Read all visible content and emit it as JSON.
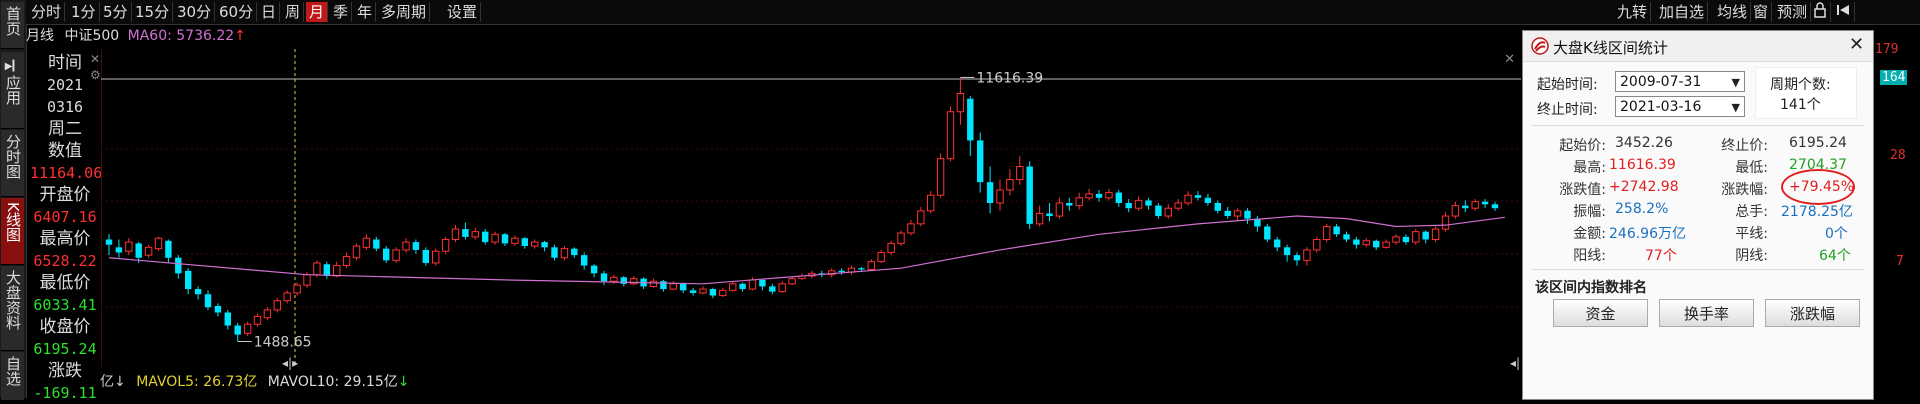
{
  "leftnav": {
    "items": [
      {
        "label": "首页",
        "active": false
      },
      {
        "label": "应用",
        "active": false
      },
      {
        "label": "分时图",
        "active": false
      },
      {
        "label": "K线图",
        "active": true
      },
      {
        "label": "大盘资料",
        "active": false
      },
      {
        "label": "自选",
        "active": false
      }
    ]
  },
  "toolbar": {
    "periods": [
      "分时",
      "1分",
      "5分",
      "15分",
      "30分",
      "60分",
      "日",
      "周",
      "月",
      "季",
      "年",
      "多周期",
      "设置"
    ],
    "active_period": "月",
    "right_items": [
      "九转",
      "加自选",
      "均线",
      "窗",
      "预测"
    ]
  },
  "info": {
    "period": "月线",
    "index_name": "中证500",
    "ma_label": "MA60: 5736.22",
    "ma_arrow": "↑"
  },
  "datapanel": {
    "time_label": "时间",
    "year": "2021",
    "date": "0316",
    "weekday": "周二",
    "value_label": "数值",
    "value": "11164.06",
    "open_label": "开盘价",
    "open": "6407.16",
    "high_label": "最高价",
    "high": "6528.22",
    "low_label": "最低价",
    "low": "6033.41",
    "close_label": "收盘价",
    "close": "6195.24",
    "change_label": "涨跌",
    "change": "-169.11",
    "cut_label": "涨跌"
  },
  "chart_data": {
    "type": "candlestick",
    "annotations": {
      "high_label": "11616.39",
      "low_label": "1488.65"
    },
    "y_range": [
      1200,
      12400
    ],
    "ma_line_label": "MA60",
    "candles": [
      {
        "o": 5400,
        "c": 5200,
        "h": 5600,
        "l": 4800
      },
      {
        "o": 5100,
        "c": 4900,
        "h": 5400,
        "l": 4700
      },
      {
        "o": 4950,
        "c": 5300,
        "h": 5450,
        "l": 4800
      },
      {
        "o": 5250,
        "c": 4700,
        "h": 5300,
        "l": 4500
      },
      {
        "o": 4800,
        "c": 5100,
        "h": 5200,
        "l": 4700
      },
      {
        "o": 5050,
        "c": 5450,
        "h": 5500,
        "l": 4950
      },
      {
        "o": 5350,
        "c": 4700,
        "h": 5400,
        "l": 4500
      },
      {
        "o": 4700,
        "c": 4100,
        "h": 4800,
        "l": 3900
      },
      {
        "o": 4200,
        "c": 3500,
        "h": 4300,
        "l": 3300
      },
      {
        "o": 3500,
        "c": 3300,
        "h": 3600,
        "l": 3100
      },
      {
        "o": 3300,
        "c": 2800,
        "h": 3450,
        "l": 2700
      },
      {
        "o": 2850,
        "c": 2600,
        "h": 2950,
        "l": 2450
      },
      {
        "o": 2600,
        "c": 2100,
        "h": 2700,
        "l": 1950
      },
      {
        "o": 2100,
        "c": 1750,
        "h": 2200,
        "l": 1488
      },
      {
        "o": 1800,
        "c": 2150,
        "h": 2250,
        "l": 1700
      },
      {
        "o": 2150,
        "c": 2450,
        "h": 2550,
        "l": 2050
      },
      {
        "o": 2400,
        "c": 2700,
        "h": 2800,
        "l": 2300
      },
      {
        "o": 2700,
        "c": 3050,
        "h": 3150,
        "l": 2600
      },
      {
        "o": 3050,
        "c": 3350,
        "h": 3450,
        "l": 2950
      },
      {
        "o": 3350,
        "c": 3650,
        "h": 3750,
        "l": 3250
      },
      {
        "o": 3650,
        "c": 4050,
        "h": 4150,
        "l": 3550
      },
      {
        "o": 4050,
        "c": 4500,
        "h": 4600,
        "l": 3950
      },
      {
        "o": 4450,
        "c": 4000,
        "h": 4550,
        "l": 3900
      },
      {
        "o": 4000,
        "c": 4400,
        "h": 4550,
        "l": 3950
      },
      {
        "o": 4400,
        "c": 4750,
        "h": 4900,
        "l": 4300
      },
      {
        "o": 4700,
        "c": 5150,
        "h": 5250,
        "l": 4600
      },
      {
        "o": 5100,
        "c": 5450,
        "h": 5600,
        "l": 5000
      },
      {
        "o": 5400,
        "c": 5050,
        "h": 5500,
        "l": 4950
      },
      {
        "o": 5050,
        "c": 4600,
        "h": 5150,
        "l": 4500
      },
      {
        "o": 4600,
        "c": 5000,
        "h": 5100,
        "l": 4500
      },
      {
        "o": 5000,
        "c": 5300,
        "h": 5450,
        "l": 4900
      },
      {
        "o": 5300,
        "c": 5000,
        "h": 5400,
        "l": 4850
      },
      {
        "o": 5000,
        "c": 4500,
        "h": 5100,
        "l": 4400
      },
      {
        "o": 4500,
        "c": 4950,
        "h": 5050,
        "l": 4400
      },
      {
        "o": 4950,
        "c": 5400,
        "h": 5500,
        "l": 4850
      },
      {
        "o": 5400,
        "c": 5800,
        "h": 5950,
        "l": 5300
      },
      {
        "o": 5800,
        "c": 5500,
        "h": 6050,
        "l": 5400
      },
      {
        "o": 5500,
        "c": 5700,
        "h": 5850,
        "l": 5400
      },
      {
        "o": 5700,
        "c": 5300,
        "h": 5800,
        "l": 5200
      },
      {
        "o": 5300,
        "c": 5600,
        "h": 5700,
        "l": 5200
      },
      {
        "o": 5600,
        "c": 5250,
        "h": 5650,
        "l": 5150
      },
      {
        "o": 5250,
        "c": 5450,
        "h": 5550,
        "l": 5150
      },
      {
        "o": 5450,
        "c": 5150,
        "h": 5500,
        "l": 5050
      },
      {
        "o": 5150,
        "c": 5300,
        "h": 5400,
        "l": 5050
      },
      {
        "o": 5300,
        "c": 5100,
        "h": 5350,
        "l": 4950
      },
      {
        "o": 5100,
        "c": 4700,
        "h": 5200,
        "l": 4600
      },
      {
        "o": 4700,
        "c": 5050,
        "h": 5150,
        "l": 4600
      },
      {
        "o": 5050,
        "c": 4800,
        "h": 5100,
        "l": 4700
      },
      {
        "o": 4800,
        "c": 4400,
        "h": 4900,
        "l": 4250
      },
      {
        "o": 4400,
        "c": 4100,
        "h": 4450,
        "l": 3950
      },
      {
        "o": 4100,
        "c": 3800,
        "h": 4200,
        "l": 3650
      },
      {
        "o": 3800,
        "c": 3950,
        "h": 4050,
        "l": 3700
      },
      {
        "o": 3950,
        "c": 3700,
        "h": 4000,
        "l": 3600
      },
      {
        "o": 3700,
        "c": 3900,
        "h": 4000,
        "l": 3650
      },
      {
        "o": 3900,
        "c": 3600,
        "h": 3950,
        "l": 3500
      },
      {
        "o": 3600,
        "c": 3800,
        "h": 3900,
        "l": 3550
      },
      {
        "o": 3800,
        "c": 3500,
        "h": 3850,
        "l": 3400
      },
      {
        "o": 3500,
        "c": 3700,
        "h": 3800,
        "l": 3450
      },
      {
        "o": 3700,
        "c": 3450,
        "h": 3750,
        "l": 3350
      },
      {
        "o": 3450,
        "c": 3350,
        "h": 3550,
        "l": 3250
      },
      {
        "o": 3350,
        "c": 3500,
        "h": 3600,
        "l": 3300
      },
      {
        "o": 3500,
        "c": 3250,
        "h": 3550,
        "l": 3150
      },
      {
        "o": 3250,
        "c": 3450,
        "h": 3550,
        "l": 3200
      },
      {
        "o": 3450,
        "c": 3700,
        "h": 3800,
        "l": 3400
      },
      {
        "o": 3700,
        "c": 3500,
        "h": 3750,
        "l": 3400
      },
      {
        "o": 3500,
        "c": 3850,
        "h": 3950,
        "l": 3450
      },
      {
        "o": 3850,
        "c": 3600,
        "h": 3900,
        "l": 3450
      },
      {
        "o": 3600,
        "c": 3400,
        "h": 3700,
        "l": 3300
      },
      {
        "o": 3400,
        "c": 3700,
        "h": 3800,
        "l": 3350
      },
      {
        "o": 3700,
        "c": 3900,
        "h": 4000,
        "l": 3650
      },
      {
        "o": 3900,
        "c": 4000,
        "h": 4100,
        "l": 3850
      },
      {
        "o": 4000,
        "c": 4100,
        "h": 4200,
        "l": 3900
      },
      {
        "o": 4100,
        "c": 4050,
        "h": 4200,
        "l": 3950
      },
      {
        "o": 4050,
        "c": 4200,
        "h": 4300,
        "l": 3950
      },
      {
        "o": 4200,
        "c": 4150,
        "h": 4300,
        "l": 4050
      },
      {
        "o": 4150,
        "c": 4300,
        "h": 4400,
        "l": 4050
      },
      {
        "o": 4300,
        "c": 4250,
        "h": 4350,
        "l": 4150
      },
      {
        "o": 4250,
        "c": 4550,
        "h": 4650,
        "l": 4200
      },
      {
        "o": 4550,
        "c": 4900,
        "h": 5000,
        "l": 4500
      },
      {
        "o": 4900,
        "c": 5250,
        "h": 5350,
        "l": 4800
      },
      {
        "o": 5250,
        "c": 5650,
        "h": 5750,
        "l": 5150
      },
      {
        "o": 5650,
        "c": 6000,
        "h": 6150,
        "l": 5550
      },
      {
        "o": 6000,
        "c": 6500,
        "h": 6650,
        "l": 5900
      },
      {
        "o": 6500,
        "c": 7100,
        "h": 7250,
        "l": 6400
      },
      {
        "o": 7100,
        "c": 8500,
        "h": 8700,
        "l": 7000
      },
      {
        "o": 8500,
        "c": 10300,
        "h": 10500,
        "l": 8400
      },
      {
        "o": 10300,
        "c": 11000,
        "h": 11616,
        "l": 9800
      },
      {
        "o": 10800,
        "c": 9200,
        "h": 10900,
        "l": 8600
      },
      {
        "o": 9200,
        "c": 7600,
        "h": 9500,
        "l": 7200
      },
      {
        "o": 7600,
        "c": 6800,
        "h": 8200,
        "l": 6400
      },
      {
        "o": 6800,
        "c": 7300,
        "h": 7700,
        "l": 6500
      },
      {
        "o": 7300,
        "c": 7700,
        "h": 8100,
        "l": 7100
      },
      {
        "o": 7700,
        "c": 8200,
        "h": 8600,
        "l": 7500
      },
      {
        "o": 8200,
        "c": 6000,
        "h": 8400,
        "l": 5800
      },
      {
        "o": 6000,
        "c": 6400,
        "h": 6700,
        "l": 5900
      },
      {
        "o": 6400,
        "c": 6300,
        "h": 6800,
        "l": 6100
      },
      {
        "o": 6300,
        "c": 6800,
        "h": 7000,
        "l": 6200
      },
      {
        "o": 6800,
        "c": 6700,
        "h": 7000,
        "l": 6500
      },
      {
        "o": 6700,
        "c": 7000,
        "h": 7200,
        "l": 6550
      },
      {
        "o": 7000,
        "c": 7150,
        "h": 7350,
        "l": 6900
      },
      {
        "o": 7150,
        "c": 7000,
        "h": 7300,
        "l": 6850
      },
      {
        "o": 7000,
        "c": 7200,
        "h": 7350,
        "l": 6900
      },
      {
        "o": 7200,
        "c": 6800,
        "h": 7300,
        "l": 6650
      },
      {
        "o": 6800,
        "c": 6600,
        "h": 6950,
        "l": 6450
      },
      {
        "o": 6600,
        "c": 6900,
        "h": 7050,
        "l": 6500
      },
      {
        "o": 6900,
        "c": 6700,
        "h": 7000,
        "l": 6550
      },
      {
        "o": 6700,
        "c": 6300,
        "h": 6800,
        "l": 6200
      },
      {
        "o": 6300,
        "c": 6600,
        "h": 6750,
        "l": 6200
      },
      {
        "o": 6600,
        "c": 6800,
        "h": 6950,
        "l": 6500
      },
      {
        "o": 6800,
        "c": 7100,
        "h": 7250,
        "l": 6700
      },
      {
        "o": 7100,
        "c": 7000,
        "h": 7250,
        "l": 6900
      },
      {
        "o": 7000,
        "c": 6800,
        "h": 7150,
        "l": 6700
      },
      {
        "o": 6800,
        "c": 6500,
        "h": 6900,
        "l": 6400
      },
      {
        "o": 6500,
        "c": 6300,
        "h": 6650,
        "l": 6200
      },
      {
        "o": 6300,
        "c": 6500,
        "h": 6600,
        "l": 6100
      },
      {
        "o": 6500,
        "c": 6200,
        "h": 6600,
        "l": 6000
      },
      {
        "o": 6200,
        "c": 5900,
        "h": 6300,
        "l": 5700
      },
      {
        "o": 5900,
        "c": 5400,
        "h": 6000,
        "l": 5300
      },
      {
        "o": 5400,
        "c": 5100,
        "h": 5500,
        "l": 4950
      },
      {
        "o": 5100,
        "c": 4800,
        "h": 5200,
        "l": 4550
      },
      {
        "o": 4800,
        "c": 4600,
        "h": 4900,
        "l": 4400
      },
      {
        "o": 4600,
        "c": 5000,
        "h": 5100,
        "l": 4400
      },
      {
        "o": 5000,
        "c": 5400,
        "h": 5500,
        "l": 4900
      },
      {
        "o": 5400,
        "c": 5900,
        "h": 6000,
        "l": 5300
      },
      {
        "o": 5900,
        "c": 5600,
        "h": 6000,
        "l": 5500
      },
      {
        "o": 5600,
        "c": 5400,
        "h": 5700,
        "l": 5300
      },
      {
        "o": 5400,
        "c": 5200,
        "h": 5500,
        "l": 5050
      },
      {
        "o": 5200,
        "c": 5350,
        "h": 5450,
        "l": 5100
      },
      {
        "o": 5350,
        "c": 5100,
        "h": 5400,
        "l": 5000
      },
      {
        "o": 5100,
        "c": 5300,
        "h": 5400,
        "l": 5050
      },
      {
        "o": 5300,
        "c": 5500,
        "h": 5600,
        "l": 5200
      },
      {
        "o": 5500,
        "c": 5300,
        "h": 5600,
        "l": 5200
      },
      {
        "o": 5300,
        "c": 5700,
        "h": 5800,
        "l": 5200
      },
      {
        "o": 5700,
        "c": 5400,
        "h": 5750,
        "l": 5250
      },
      {
        "o": 5400,
        "c": 5800,
        "h": 5900,
        "l": 5300
      },
      {
        "o": 5800,
        "c": 6300,
        "h": 6450,
        "l": 5700
      },
      {
        "o": 6300,
        "c": 6700,
        "h": 6850,
        "l": 6200
      },
      {
        "o": 6700,
        "c": 6600,
        "h": 6900,
        "l": 6450
      },
      {
        "o": 6600,
        "c": 6850,
        "h": 6950,
        "l": 6500
      },
      {
        "o": 6850,
        "c": 6750,
        "h": 6950,
        "l": 6600
      },
      {
        "o": 6750,
        "c": 6600,
        "h": 6850,
        "l": 6500
      }
    ],
    "ma60": [
      [
        0,
        4700
      ],
      [
        20,
        4050
      ],
      [
        40,
        3850
      ],
      [
        60,
        3700
      ],
      [
        80,
        4300
      ],
      [
        90,
        5000
      ],
      [
        100,
        5600
      ],
      [
        110,
        6000
      ],
      [
        120,
        6300
      ],
      [
        125,
        6200
      ],
      [
        130,
        5900
      ],
      [
        135,
        5950
      ],
      [
        141,
        6250
      ]
    ]
  },
  "bottombar": {
    "unit_prefix": "亿↓",
    "mavol5_label": "MAVOL5:",
    "mavol5_value": "26.73亿",
    "mavol10_label": "MAVOL10:",
    "mavol10_value": "29.15亿",
    "mavol10_arrow": "↓"
  },
  "right_axis": [
    "179",
    "164",
    "28",
    "7"
  ],
  "popup": {
    "title": "大盘K线区间统计",
    "start_label": "起始时间:",
    "start_value": "2009-07-31",
    "end_label": "终止时间:",
    "end_value": "2021-03-16",
    "period_count_label": "周期个数:",
    "period_count_value": "141个",
    "stats": {
      "start_price_label": "起始价:",
      "start_price": "3452.26",
      "end_price_label": "终止价:",
      "end_price": "6195.24",
      "high_label": "最高:",
      "high": "11616.39",
      "low_label": "最低:",
      "low": "2704.37",
      "change_value_label": "涨跌值:",
      "change_value": "+2742.98",
      "change_pct_label": "涨跌幅:",
      "change_pct": "+79.45%",
      "amplitude_label": "振幅:",
      "amplitude": "258.2%",
      "volume_label": "总手:",
      "volume": "2178.25亿",
      "amount_label": "金额:",
      "amount": "246.96万亿",
      "flat_label": "平线:",
      "flat": "0个",
      "yang_label": "阳线:",
      "yang": "77个",
      "yin_label": "阴线:",
      "yin": "64个"
    },
    "ranking_label": "该区间内指数排名",
    "buttons": [
      "资金",
      "换手率",
      "涨跌幅"
    ]
  },
  "colors": {
    "up": "#ff3030",
    "down": "#00e5ff",
    "ma60": "#d070d0",
    "accent_red": "#c01818"
  }
}
